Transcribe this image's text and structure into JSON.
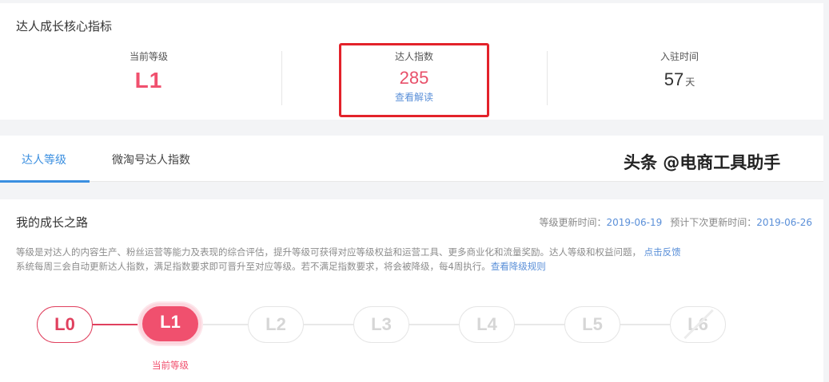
{
  "core": {
    "title": "达人成长核心指标",
    "current_level_label": "当前等级",
    "current_level_value": "L1",
    "index_label": "达人指数",
    "index_value": "285",
    "index_link": "查看解读",
    "join_label": "入驻时间",
    "join_days": "57",
    "join_unit": "天"
  },
  "tabs": [
    {
      "label": "达人等级",
      "active": true
    },
    {
      "label": "微淘号达人指数",
      "active": false
    }
  ],
  "growth": {
    "title": "我的成长之路",
    "update_label": "等级更新时间：",
    "update_date": "2019-06-19",
    "next_label": "预计下次更新时间：",
    "next_date": "2019-06-26",
    "desc_line1": "等级是对达人的内容生产、粉丝运营等能力及表现的综合评估，提升等级可获得对应等级权益和运营工具、更多商业化和流量奖励。达人等级和权益问题，",
    "desc_link1": "点击反馈",
    "desc_line2": "系统每周三会自动更新达人指数，满足指数要求即可晋升至对应等级。若不满足指数要求，将会被降级，每4周执行。",
    "desc_link2": "查看降级规则",
    "levels": [
      "L0",
      "L1",
      "L2",
      "L3",
      "L4",
      "L5",
      "L6"
    ],
    "current_level_caption": "当前等级"
  },
  "watermark": "头条 @电商工具助手",
  "colors": {
    "accent_pink": "#f0506e",
    "link_blue": "#5a8fd8",
    "tab_blue": "#3b8fe0",
    "highlight_red": "#e3222a"
  }
}
